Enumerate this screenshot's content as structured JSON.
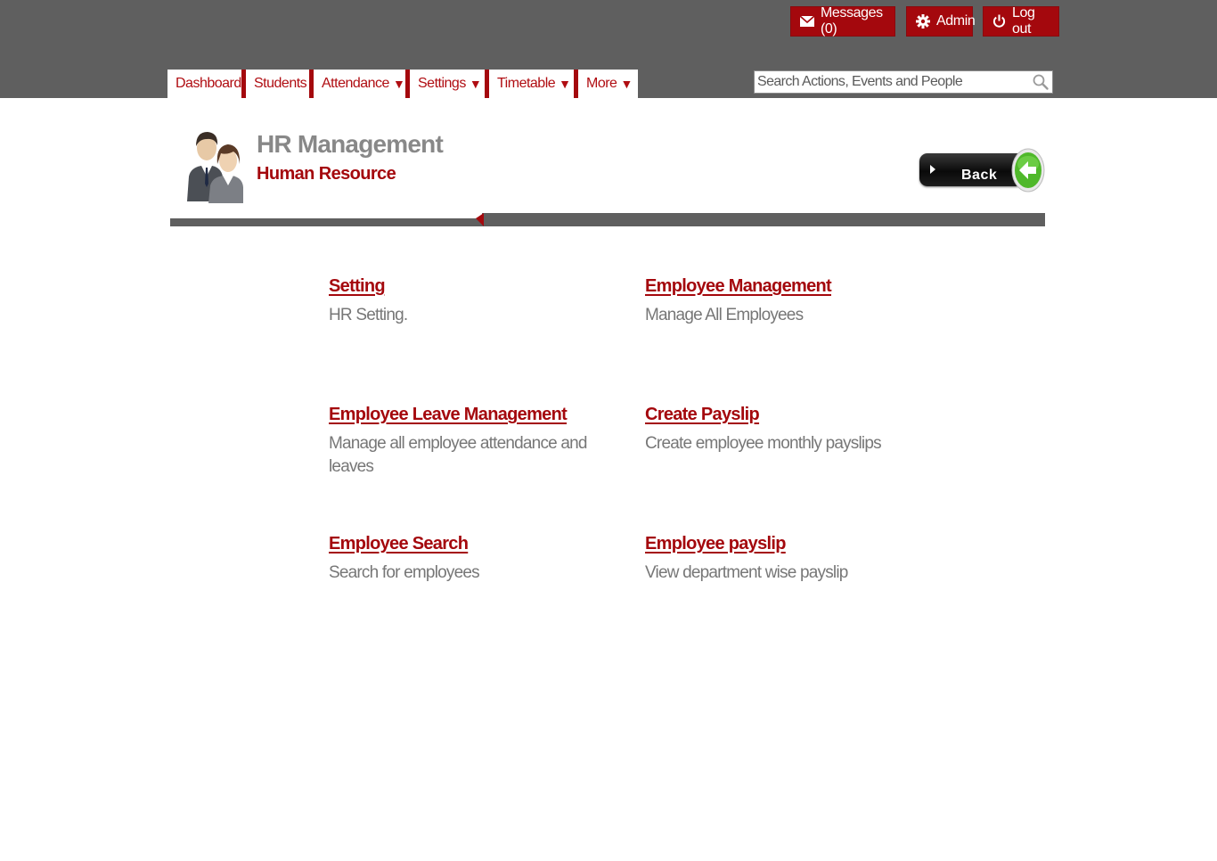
{
  "header": {
    "user_buttons": {
      "messages": "Messages (0)",
      "admin": "Admin",
      "logout": "Log out"
    },
    "nav": [
      {
        "label": "Dashboard",
        "dropdown": false
      },
      {
        "label": "Students",
        "dropdown": false
      },
      {
        "label": "Attendance",
        "dropdown": true
      },
      {
        "label": "Settings",
        "dropdown": true
      },
      {
        "label": "Timetable",
        "dropdown": true
      },
      {
        "label": "More",
        "dropdown": true
      }
    ],
    "dropdown_arrow": "▼",
    "search": {
      "placeholder": "Search Actions, Events and People",
      "value": ""
    }
  },
  "page": {
    "title": "HR Management",
    "subtitle": "Human Resource",
    "back_label": "Back"
  },
  "modules": [
    {
      "label": "Setting",
      "description": "HR Setting."
    },
    {
      "label": "Employee Management",
      "description": "Manage All Employees"
    },
    {
      "label": "Employee Leave Management",
      "description": "Manage all employee attendance and leaves"
    },
    {
      "label": "Create Payslip",
      "description": "Create employee monthly payslips"
    },
    {
      "label": "Employee Search",
      "description": "Search for employees"
    },
    {
      "label": "Employee payslip",
      "description": "View department wise payslip"
    }
  ],
  "colors": {
    "header_bg": "#5f5f5f",
    "accent_red": "#a4080d",
    "title_gray": "#888888",
    "text_gray": "#777777"
  },
  "icons": {
    "messages": "envelope-icon",
    "admin": "gear-icon",
    "logout": "power-icon",
    "search": "search-icon",
    "page": "hr-people-icon",
    "back": "back-arrow-icon"
  }
}
